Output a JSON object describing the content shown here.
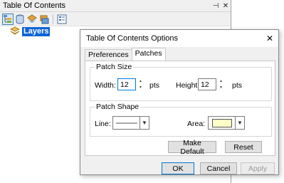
{
  "toc": {
    "title": "Table Of Contents",
    "pin_glyph": "⊣",
    "close_glyph": "✕",
    "tree_root_label": "Layers",
    "toolbar_icons": [
      "list-by-drawing-order-icon",
      "list-by-source-icon",
      "list-by-visibility-icon",
      "list-by-selection-icon",
      "options-icon"
    ]
  },
  "dialog": {
    "title": "Table Of Contents Options",
    "close_glyph": "✕",
    "tabs": [
      {
        "label": "Preferences",
        "selected": false
      },
      {
        "label": "Patches",
        "selected": true
      }
    ],
    "patch_size": {
      "group_label": "Patch Size",
      "width_label": "Width:",
      "width_value": "12",
      "height_label": "Height:",
      "height_value": "12",
      "unit": "pts"
    },
    "patch_shape": {
      "group_label": "Patch Shape",
      "line_label": "Line:",
      "area_label": "Area:",
      "area_color": "#ffffc8"
    },
    "buttons": {
      "make_default": "Make Default",
      "reset": "Reset",
      "ok": "OK",
      "cancel": "Cancel",
      "apply": "Apply"
    }
  },
  "colors": {
    "selection": "#0a64d6",
    "focus_border": "#0078d7"
  }
}
